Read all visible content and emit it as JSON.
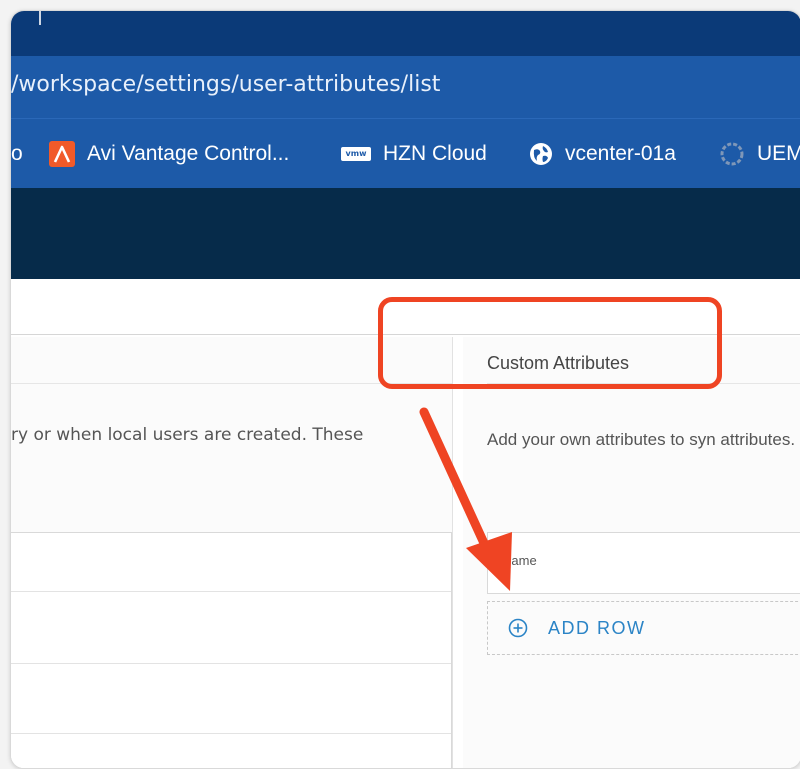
{
  "browser": {
    "url": "/workspace/settings/user-attributes/list",
    "bookmarks": [
      {
        "label": "o",
        "icon": "bookmark-icon"
      },
      {
        "label": "Avi Vantage Control...",
        "icon": "avi-icon"
      },
      {
        "label": "HZN Cloud",
        "icon": "vmware-icon"
      },
      {
        "label": "vcenter-01a",
        "icon": "globe-icon"
      },
      {
        "label": "UEM",
        "icon": "uem-icon"
      }
    ],
    "vmw_badge": "vmw"
  },
  "left_panel": {
    "description": "ry or when local users are created. These"
  },
  "custom_attributes": {
    "title": "Custom Attributes",
    "description": "Add your own attributes to syn attributes.",
    "table_header": "Name",
    "add_row_label": "ADD ROW"
  },
  "colors": {
    "annotation": "#ef4423",
    "link": "#2b84c6",
    "address_bar": "#1d5aa8",
    "header_dark": "#062b4a"
  }
}
